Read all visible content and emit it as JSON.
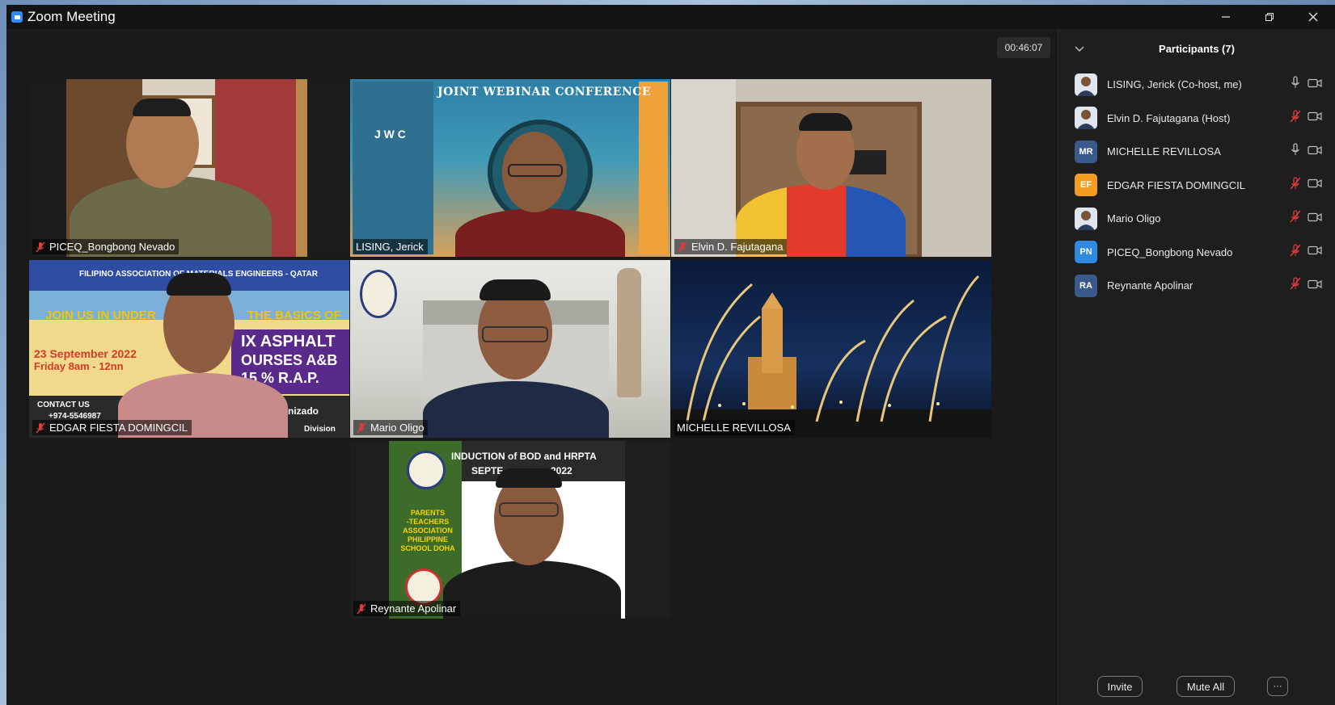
{
  "window": {
    "title": "Zoom Meeting",
    "controls": [
      "minimize",
      "restore",
      "close"
    ]
  },
  "meeting": {
    "timer": "00:46:07"
  },
  "tiles": [
    {
      "name": "PICEQ_Bongbong Nevado",
      "muted": true
    },
    {
      "name": "LISING, Jerick",
      "muted": false,
      "speaking": true,
      "background": {
        "title": "JOINT WEBINAR CONFERENCE",
        "acronym": "J W C"
      }
    },
    {
      "name": "Elvin D. Fajutagana",
      "muted": true
    },
    {
      "name": "EDGAR FIESTA DOMINGCIL",
      "muted": true,
      "background": {
        "header": "FILIPINO ASSOCIATION OF MATERIALS ENGINEERS - QATAR",
        "line1": "JOIN US IN UNDER",
        "line1b": "THE BASICS OF",
        "line2": "IX ASPHALT",
        "line3": "OURSES A&B",
        "line4": "15 % R.A.P.",
        "date": "23 September 2022",
        "time": "Friday 8am - 12nn",
        "contact": "CONTACT US",
        "phone": "+974-5546987",
        "org": "nizado",
        "division": "Division"
      }
    },
    {
      "name": "Mario Oligo",
      "muted": true
    },
    {
      "name": "MICHELLE REVILLOSA",
      "muted": false
    },
    {
      "name": "Reynante Apolinar",
      "muted": true,
      "background": {
        "title": "INDUCTION of BOD and HRPTA",
        "date": "SEPTE",
        "year": "2022",
        "side": [
          "PARENTS",
          "-TEACHERS",
          "ASSOCIATION",
          "PHILIPPINE",
          "SCHOOL DOHA"
        ]
      }
    }
  ],
  "participants": {
    "title": "Participants (7)",
    "list": [
      {
        "name": "LISING, Jerick (Co-host, me)",
        "initials": "",
        "color": "#ffffff",
        "photo": true,
        "mic": "on",
        "video": "off"
      },
      {
        "name": "Elvin D. Fajutagana (Host)",
        "initials": "",
        "color": "#ffffff",
        "photo": true,
        "mic": "muted",
        "video": "off"
      },
      {
        "name": "MICHELLE REVILLOSA",
        "initials": "MR",
        "color": "#3b5a8c",
        "photo": false,
        "mic": "on",
        "video": "off"
      },
      {
        "name": "EDGAR FIESTA DOMINGCIL",
        "initials": "EF",
        "color": "#f29d1f",
        "photo": false,
        "mic": "muted",
        "video": "off"
      },
      {
        "name": "Mario Oligo",
        "initials": "",
        "color": "#ffffff",
        "photo": true,
        "mic": "muted",
        "video": "off"
      },
      {
        "name": "PICEQ_Bongbong Nevado",
        "initials": "PN",
        "color": "#2e8be0",
        "photo": false,
        "mic": "muted",
        "video": "off"
      },
      {
        "name": "Reynante Apolinar",
        "initials": "RA",
        "color": "#3b5a8c",
        "photo": false,
        "mic": "muted",
        "video": "off"
      }
    ],
    "invite_label": "Invite",
    "mute_all_label": "Mute All",
    "more_label": "···"
  },
  "colors": {
    "muted_red": "#e23b3b",
    "speaking_outline": "#d7e24a",
    "zoom_blue": "#2d8cff"
  }
}
